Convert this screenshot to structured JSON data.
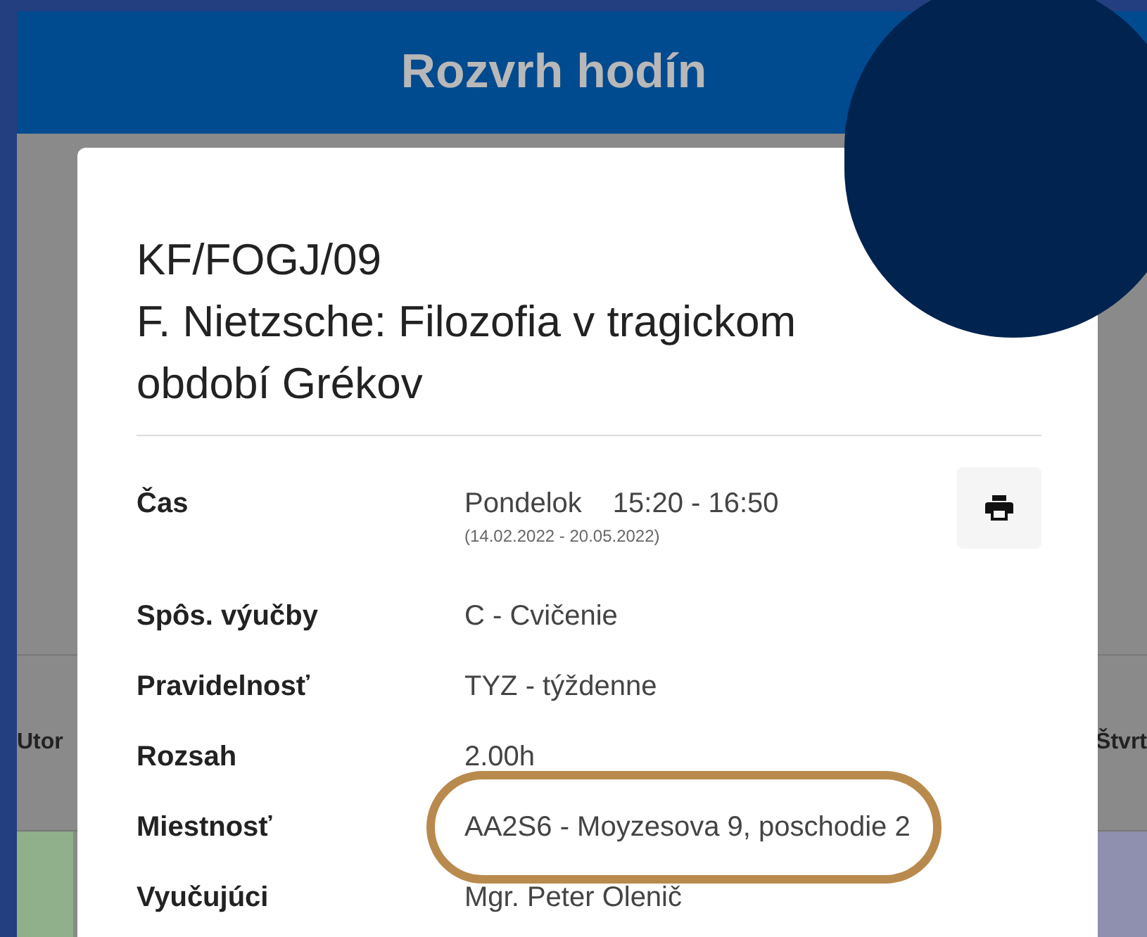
{
  "header": {
    "title": "Rozvrh hodín"
  },
  "background": {
    "days": [
      {
        "label": "Utor",
        "color": "#8fb08a"
      },
      {
        "label": "Štvrt",
        "color": "#8f8fb0"
      }
    ]
  },
  "dialog": {
    "code": "KF/FOGJ/09",
    "title": "F. Nietzsche: Filozofia v tragickom období Grékov",
    "rows": [
      {
        "label": "Čas",
        "value": "Pondelok",
        "time": "15:20 - 16:50",
        "note": "(14.02.2022 - 20.05.2022)",
        "highlighted": false
      },
      {
        "label": "Spôs. výučby",
        "value": "C - Cvičenie",
        "highlighted": false
      },
      {
        "label": "Pravidelnosť",
        "value": "TYZ - týždenne",
        "highlighted": false
      },
      {
        "label": "Rozsah",
        "value": "2.00h",
        "highlighted": false
      },
      {
        "label": "Miestnosť",
        "value": "AA2S6 - Moyzesova 9, poschodie 2",
        "highlighted": true
      },
      {
        "label": "Vyučujúci",
        "value": "Mgr. Peter Olenič",
        "highlighted": false
      }
    ]
  }
}
